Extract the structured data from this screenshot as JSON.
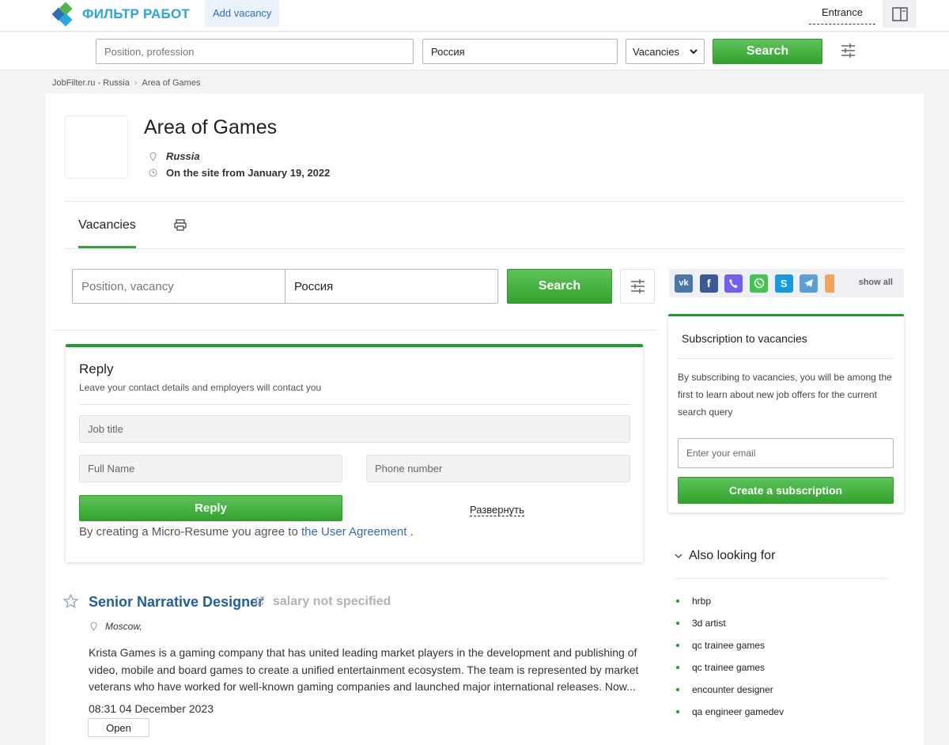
{
  "header": {
    "logo_text": "ФИЛЬТР РАБОТ",
    "add_vacancy": "Add vacancy",
    "entrance": "Entrance"
  },
  "search": {
    "position_placeholder": "Position, profession",
    "location_value": "Россия",
    "type_selected": "Vacancies",
    "button": "Search"
  },
  "breadcrumb": [
    "JobFilter.ru - Russia",
    "Area of Games"
  ],
  "company": {
    "name": "Area of Games",
    "location": "Russia",
    "since": "On the site from January 19, 2022"
  },
  "tabs": {
    "vacancies": "Vacancies"
  },
  "search2": {
    "position_placeholder": "Position, vacancy",
    "location_value": "Россия",
    "button": "Search"
  },
  "share": {
    "show_all": "show all"
  },
  "reply": {
    "title": "Reply",
    "subtitle": "Leave your contact details and employers will contact you",
    "job_title_placeholder": "Job title",
    "full_name_placeholder": "Full Name",
    "phone_placeholder": "Phone number",
    "button": "Reply",
    "expand": "Развернуть",
    "agree_text": "By creating a Micro-Resume you agree to",
    "agree_link": "the User Agreement",
    "agree_end": "."
  },
  "subscription": {
    "title": "Subscription to vacancies",
    "description": "By subscribing to vacancies, you will be among the first to learn about new job offers for the current search query",
    "email_placeholder": "Enter your email",
    "button": "Create a subscription"
  },
  "also_looking": {
    "title": "Also looking for",
    "items": [
      "hrbp",
      "3d artist",
      "qc trainee games",
      "qc trainee games",
      "encounter designer",
      "qa engineer gamedev"
    ]
  },
  "vacancy": {
    "title": "Senior Narrative Designer",
    "salary": "salary not specified",
    "location": "Moscow,",
    "description": "Krista Games is a gaming company that has united leading market players in the development and publishing of video, mobile and board games to create a unified entertainment ecosystem. The team is represented by market veterans who have worked for well-known gaming companies and launched major international releases. Now...",
    "date": "08:31 04 December 2023",
    "open_button": "Open"
  },
  "colors": {
    "accent_green": "#2ea43a",
    "link_blue": "#1e5fa3",
    "logo_blue": "#27a7dc"
  }
}
